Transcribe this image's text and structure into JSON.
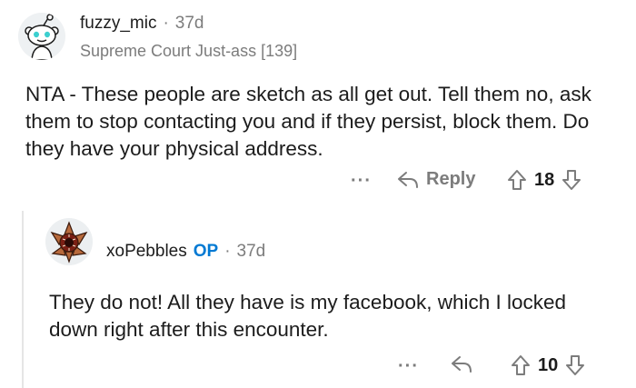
{
  "comment": {
    "username": "fuzzy_mic",
    "separator": "·",
    "age": "37d",
    "flair": "Supreme Court Just-ass [139]",
    "body": "NTA - These people are sketch as all get out. Tell them no, ask them to stop contacting you and if they persist, block them. Do they have your physical address.",
    "more_label": "···",
    "reply_label": "Reply",
    "score": "18",
    "avatar_icon": "snoo-avatar-icon"
  },
  "reply": {
    "username": "xoPebbles",
    "op_badge": "OP",
    "separator": "·",
    "age": "37d",
    "body": "They do not! All they have is my facebook, which I locked down right after this encounter.",
    "more_label": "···",
    "score": "10",
    "avatar_icon": "demogorgon-avatar-icon"
  },
  "colors": {
    "text": "#1c1c1c",
    "meta": "#7c7c7c",
    "op": "#0079d3",
    "thread_line": "#e5e5e5"
  }
}
